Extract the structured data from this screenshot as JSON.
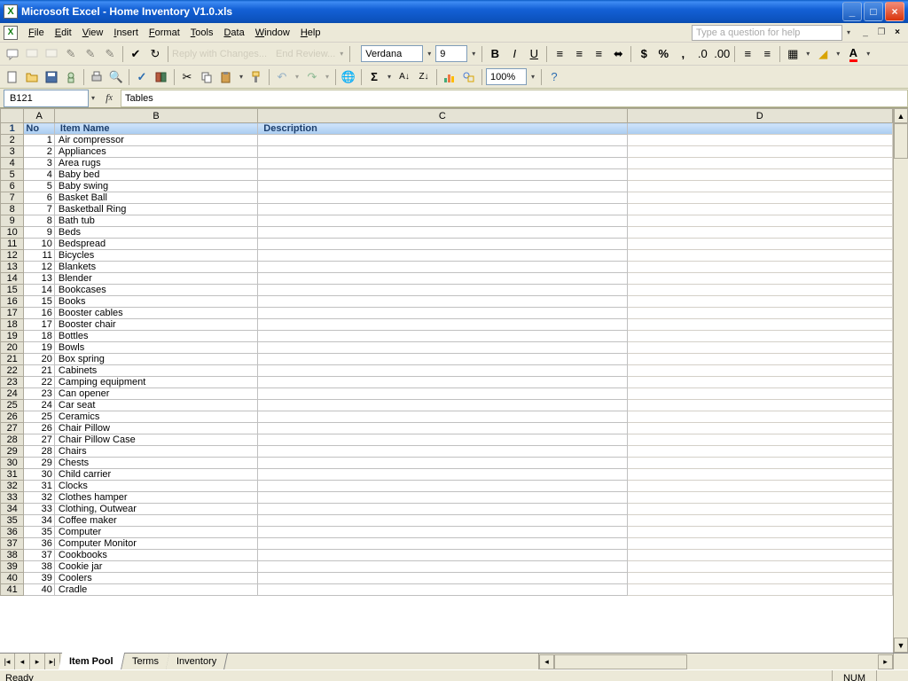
{
  "titlebar": {
    "app": "Microsoft Excel",
    "doc": "Home Inventory V1.0.xls"
  },
  "menus": [
    "File",
    "Edit",
    "View",
    "Insert",
    "Format",
    "Tools",
    "Data",
    "Window",
    "Help"
  ],
  "help_placeholder": "Type a question for help",
  "reviewing": {
    "reply": "Reply with Changes...",
    "end": "End Review..."
  },
  "format": {
    "font": "Verdana",
    "size": "9",
    "zoom": "100%"
  },
  "namebox": {
    "ref": "B121",
    "formula": "Tables"
  },
  "columns": [
    "A",
    "B",
    "C",
    "D"
  ],
  "headers": {
    "no": "No",
    "item": "Item Name",
    "desc": "Description"
  },
  "rows": [
    {
      "n": 1,
      "name": "Air compressor"
    },
    {
      "n": 2,
      "name": "Appliances"
    },
    {
      "n": 3,
      "name": "Area rugs"
    },
    {
      "n": 4,
      "name": "Baby bed"
    },
    {
      "n": 5,
      "name": "Baby swing"
    },
    {
      "n": 6,
      "name": "Basket Ball"
    },
    {
      "n": 7,
      "name": "Basketball Ring"
    },
    {
      "n": 8,
      "name": "Bath tub"
    },
    {
      "n": 9,
      "name": "Beds"
    },
    {
      "n": 10,
      "name": "Bedspread"
    },
    {
      "n": 11,
      "name": "Bicycles"
    },
    {
      "n": 12,
      "name": "Blankets"
    },
    {
      "n": 13,
      "name": "Blender"
    },
    {
      "n": 14,
      "name": "Bookcases"
    },
    {
      "n": 15,
      "name": "Books"
    },
    {
      "n": 16,
      "name": "Booster cables"
    },
    {
      "n": 17,
      "name": "Booster chair"
    },
    {
      "n": 18,
      "name": "Bottles"
    },
    {
      "n": 19,
      "name": "Bowls"
    },
    {
      "n": 20,
      "name": "Box spring"
    },
    {
      "n": 21,
      "name": "Cabinets"
    },
    {
      "n": 22,
      "name": "Camping equipment"
    },
    {
      "n": 23,
      "name": "Can opener"
    },
    {
      "n": 24,
      "name": "Car seat"
    },
    {
      "n": 25,
      "name": "Ceramics"
    },
    {
      "n": 26,
      "name": "Chair Pillow"
    },
    {
      "n": 27,
      "name": "Chair Pillow Case"
    },
    {
      "n": 28,
      "name": "Chairs"
    },
    {
      "n": 29,
      "name": "Chests"
    },
    {
      "n": 30,
      "name": "Child carrier"
    },
    {
      "n": 31,
      "name": "Clocks"
    },
    {
      "n": 32,
      "name": "Clothes hamper"
    },
    {
      "n": 33,
      "name": "Clothing, Outwear"
    },
    {
      "n": 34,
      "name": "Coffee maker"
    },
    {
      "n": 35,
      "name": "Computer"
    },
    {
      "n": 36,
      "name": "Computer Monitor"
    },
    {
      "n": 37,
      "name": "Cookbooks"
    },
    {
      "n": 38,
      "name": "Cookie jar"
    },
    {
      "n": 39,
      "name": "Coolers"
    },
    {
      "n": 40,
      "name": "Cradle"
    }
  ],
  "tabs": [
    "Item Pool",
    "Terms",
    "Inventory"
  ],
  "active_tab": 0,
  "status": {
    "ready": "Ready",
    "num": "NUM"
  }
}
